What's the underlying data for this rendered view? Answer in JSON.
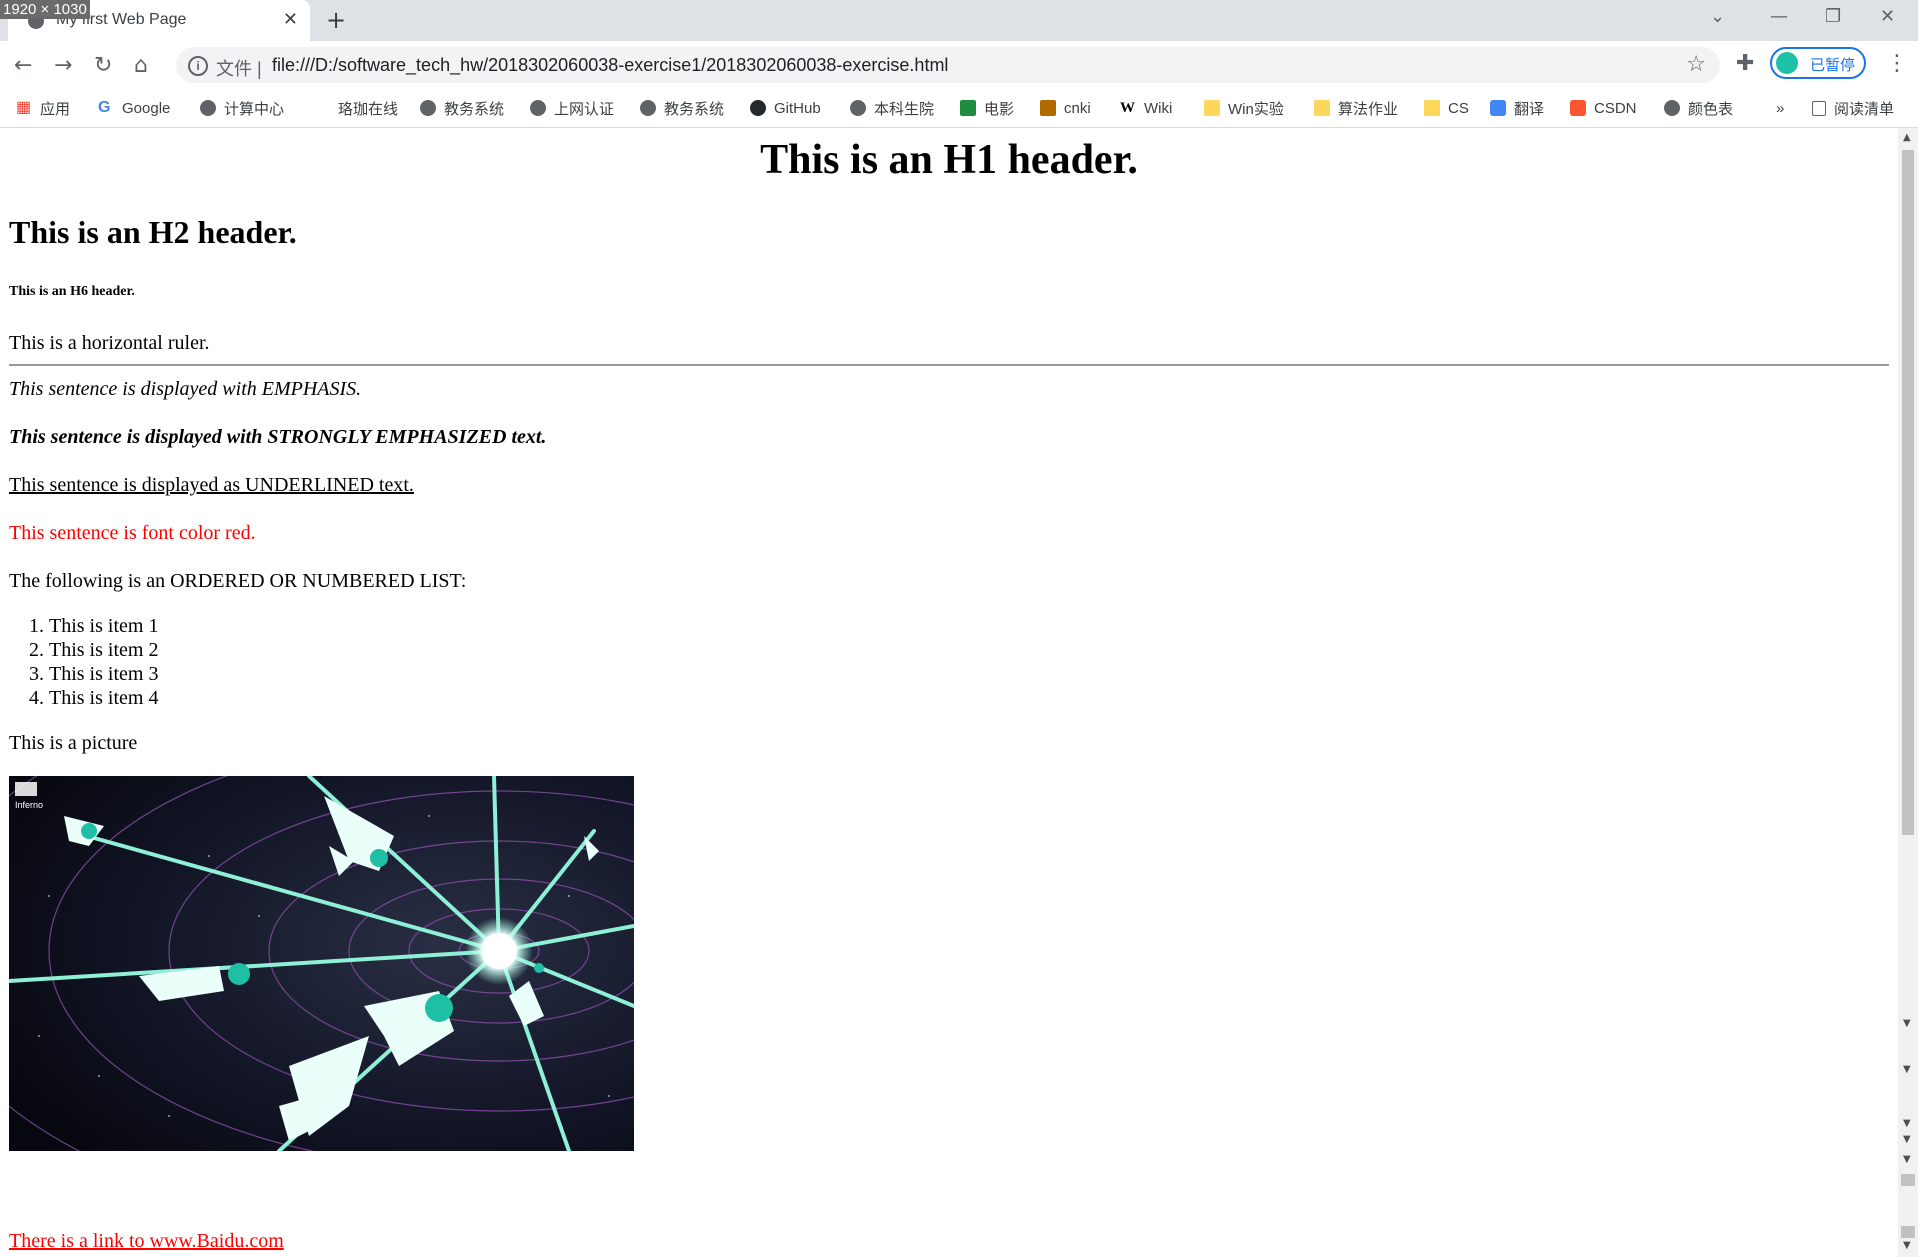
{
  "screen_label": "1920 × 1030",
  "browser": {
    "tab_title": "My first Web Page",
    "new_tab_label": "+",
    "address": {
      "file_label": "文件 |",
      "url": "file:///D:/software_tech_hw/2018302060038-exercise1/2018302060038-exercise.html"
    },
    "profile_label": "已暂停",
    "bookmarks": [
      {
        "label": "应用",
        "icon": "apps-icon"
      },
      {
        "label": "Google",
        "icon": "google-icon"
      },
      {
        "label": "计算中心",
        "icon": "globe-icon"
      },
      {
        "label": "珞珈在线",
        "icon": "none"
      },
      {
        "label": "教务系统",
        "icon": "globe-icon"
      },
      {
        "label": "上网认证",
        "icon": "globe-icon"
      },
      {
        "label": "教务系统",
        "icon": "globe-icon"
      },
      {
        "label": "GitHub",
        "icon": "github-icon"
      },
      {
        "label": "本科生院",
        "icon": "globe-icon"
      },
      {
        "label": "电影",
        "icon": "douban-icon"
      },
      {
        "label": "cnki",
        "icon": "cnki-icon"
      },
      {
        "label": "Wiki",
        "icon": "wikipedia-icon"
      },
      {
        "label": "Win实验",
        "icon": "folder-icon"
      },
      {
        "label": "算法作业",
        "icon": "folder-icon"
      },
      {
        "label": "CS",
        "icon": "folder-icon"
      },
      {
        "label": "翻译",
        "icon": "translate-icon"
      },
      {
        "label": "CSDN",
        "icon": "csdn-icon"
      },
      {
        "label": "颜色表",
        "icon": "globe-icon"
      }
    ],
    "bookmarks_overflow": "»",
    "reading_list": "阅读清单"
  },
  "page": {
    "h1": "This is an H1 header.",
    "h2": "This is an H2 header.",
    "h6": "This is an H6 header.",
    "ruler_text": "This is a horizontal ruler.",
    "emphasis": "This sentence is displayed with EMPHASIS.",
    "strong": "This sentence is displayed with STRONGLY EMPHASIZED text.",
    "underline": "This sentence is displayed as UNDERLINED text.",
    "red": "This sentence is font color red.",
    "list_intro": "The following is an ORDERED OR NUMBERED LIST:",
    "list_items": [
      "This is item 1",
      "This is item 2",
      "This is item 3",
      "This is item 4"
    ],
    "picture_label": "This is a picture",
    "picture_watermark": "Inferno",
    "link_text": "There is a link to www.Baidu.com"
  },
  "colors": {
    "link": "#ff0000",
    "red_text": "#ff0000"
  }
}
